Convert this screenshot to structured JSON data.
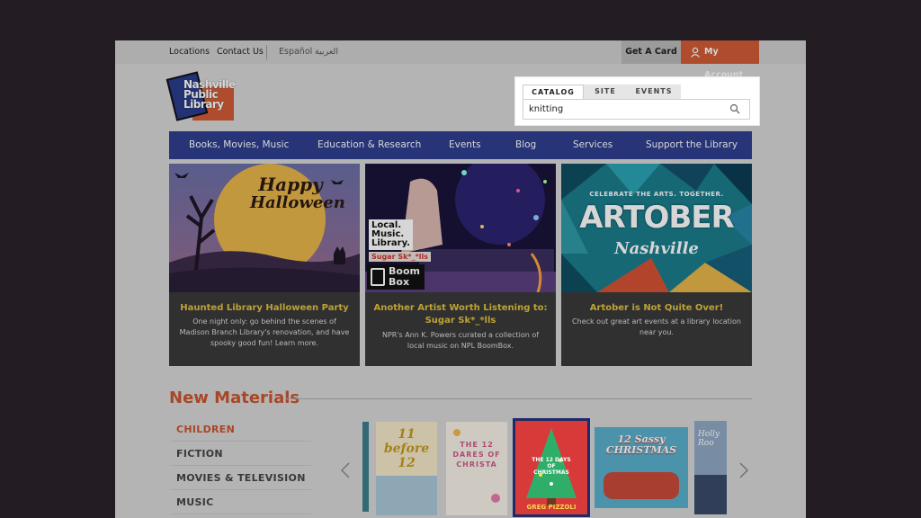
{
  "topbar": {
    "locations": "Locations",
    "contact": "Contact Us",
    "espanol": "Español",
    "arabic": "العربية",
    "get_card": "Get A Card",
    "my_account": "My Account"
  },
  "logo": {
    "line1": "Nashville",
    "line2": "Public",
    "line3": "Library"
  },
  "search": {
    "tabs": [
      "CATALOG",
      "SITE",
      "EVENTS"
    ],
    "value": "knitting"
  },
  "nav": [
    "Books, Movies, Music",
    "Education & Research",
    "Events",
    "Blog",
    "Services",
    "Support the Library"
  ],
  "cards": [
    {
      "art_text1": "Happy",
      "art_text2": "Halloween",
      "title": "Haunted Library Halloween Party",
      "desc": "One night only: go behind the scenes of Madison Branch Library's renovation, and have spooky good fun! Learn more."
    },
    {
      "art_text": [
        "Local.",
        "Music.",
        "Library."
      ],
      "art_tag": "Sugar Sk*_*lls",
      "art_logo1": "Boom",
      "art_logo2": "Box",
      "title": "Another Artist Worth Listening to: Sugar Sk*_*lls",
      "desc": "NPR's Ann K. Powers curated a collection of local music on NPL BoomBox."
    },
    {
      "art_sub": "CELEBRATE THE ARTS. TOGETHER.",
      "art_big": "ARTOBER",
      "art_city": "Nashville",
      "title": "Artober is Not Quite Over!",
      "desc": "Check out great art events at a library location near you."
    }
  ],
  "new_materials": {
    "title": "New Materials",
    "categories": [
      "CHILDREN",
      "FICTION",
      "MOVIES & TELEVISION",
      "MUSIC"
    ],
    "books": [
      {
        "title": "11 before 12"
      },
      {
        "title": "THE 12 DARES OF CHRISTA"
      },
      {
        "title": "THE 12 DAYS OF CHRISTMAS",
        "author": "GREG PIZZOLI"
      },
      {
        "title": "12 Sassy CHRISTMAS"
      },
      {
        "title": "Holly Roo"
      }
    ]
  },
  "colors": {
    "accent": "#d15b36",
    "nav": "#2f3f8e",
    "gold": "#e2c140"
  }
}
